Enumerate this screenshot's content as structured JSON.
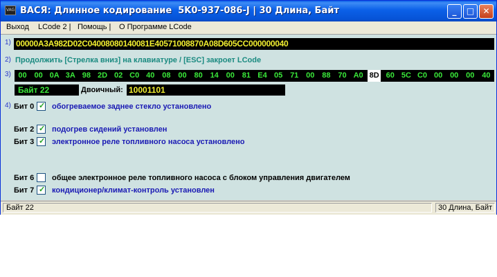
{
  "window": {
    "title": "ВАСЯ: Длинное кодирование  5K0-937-086-J | 30 Длина, Байт",
    "app_icon": "vcds-app-icon",
    "icon_text": "VAG"
  },
  "menu": {
    "items": [
      "Выход",
      "LCode 2 |",
      "Помощь |",
      "О Программе LCode"
    ]
  },
  "row1": {
    "num": "1)",
    "code": "00000A3A982D02C04008080140081E40571008870A08D605CC000000040"
  },
  "row2": {
    "num": "2)",
    "hint": "Продолжить [Стрелка вниз] на клавиатуре / [ESC] закроет LCode"
  },
  "row3": {
    "num": "3)",
    "bytes": [
      "00",
      "00",
      "0A",
      "3A",
      "98",
      "2D",
      "02",
      "C0",
      "40",
      "08",
      "00",
      "80",
      "14",
      "00",
      "81",
      "E4",
      "05",
      "71",
      "00",
      "88",
      "70",
      "A0",
      "8D",
      "60",
      "5C",
      "C0",
      "00",
      "00",
      "00",
      "40"
    ],
    "selected_index": 22,
    "byte_label": "Байт 22",
    "binary_label": "Двоичный:",
    "binary_value": "10001101"
  },
  "row4": {
    "num": "4)",
    "bits": [
      {
        "label": "Бит 0",
        "checked": true,
        "desc": "обогреваемое заднее стекло установлено"
      },
      {
        "label": "Бит 2",
        "checked": true,
        "desc": "подогрев сидений установлен"
      },
      {
        "label": "Бит 3",
        "checked": true,
        "desc": "электронное реле топливного насоса установлено"
      },
      {
        "label": "Бит 6",
        "checked": false,
        "desc": "общее электронное реле топливного насоса с блоком управления двигателем"
      },
      {
        "label": "Бит 7",
        "checked": true,
        "desc": "кондиционер/климат-контроль установлен"
      }
    ]
  },
  "status": {
    "left": "Байт 22",
    "right": "30 Длина, Байт"
  },
  "colors": {
    "title_blue": "#0653d6",
    "client_bg": "#cfe2e1",
    "byte_green": "#3ae83a",
    "code_yellow": "#f2ef30",
    "desc_blue": "#1a1ab4",
    "hint_teal": "#1a8a80"
  }
}
